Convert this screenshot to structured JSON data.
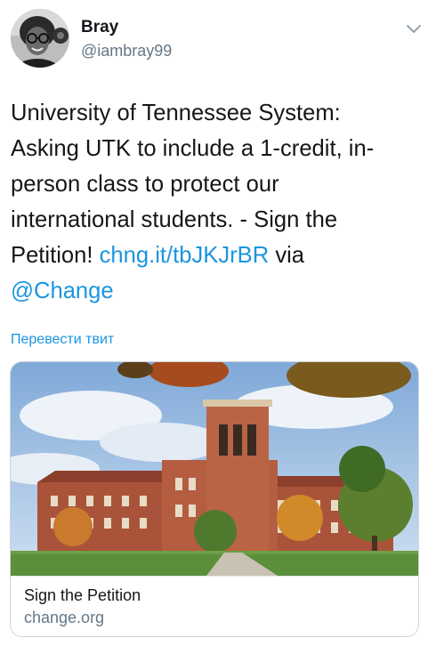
{
  "user": {
    "display_name": "Bray",
    "handle": "@iambray99",
    "avatar_icon": "profile-photo"
  },
  "header": {
    "menu_icon": "chevron-down-icon"
  },
  "tweet": {
    "text_lines": [
      "University of Tennessee System:",
      "Asking UTK to include a 1-credit, in-",
      "person class to protect our",
      "international students. - Sign the"
    ],
    "line5_prefix": "Petition! ",
    "link_url": "chng.it/tbJKJrBR",
    "line5_suffix": " via",
    "mention": "@Change",
    "translate_label": "Перевести твит"
  },
  "card": {
    "image_icon": "university-building-photo",
    "title": "Sign the Petition",
    "domain": "change.org"
  },
  "colors": {
    "link": "#1b95e0",
    "secondary_text": "#657786",
    "primary_text": "#14171a",
    "border": "#ccd6dd"
  }
}
